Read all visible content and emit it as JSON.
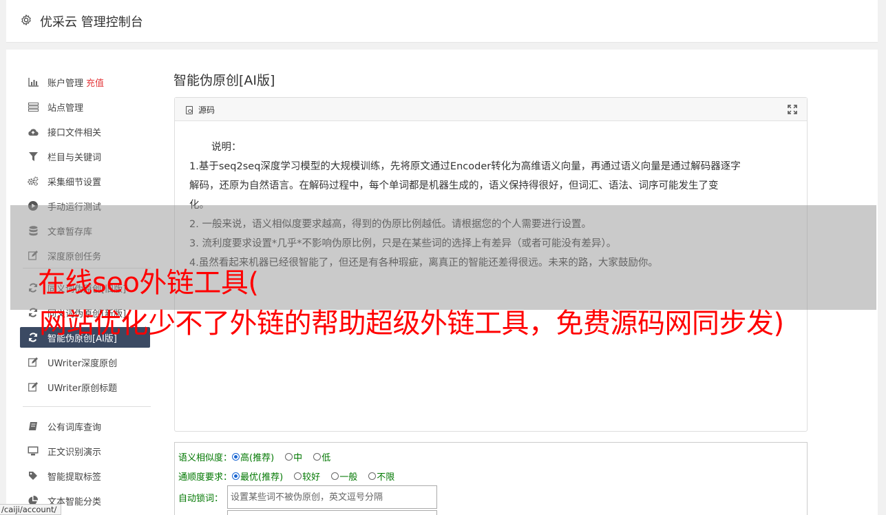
{
  "header": {
    "title": "优采云 管理控制台",
    "icon": "gear-icon"
  },
  "sidebar": {
    "items": [
      {
        "label": "账户管理",
        "extra": "充值",
        "icon": "bar-chart-icon"
      },
      {
        "label": "站点管理",
        "icon": "server-icon"
      },
      {
        "label": "接口文件相关",
        "icon": "cloud-upload-icon"
      },
      {
        "label": "栏目与关键词",
        "icon": "filter-icon"
      },
      {
        "label": "采集细节设置",
        "icon": "gears-icon"
      },
      {
        "label": "手动运行测试",
        "icon": "play-circle-icon"
      },
      {
        "label": "文章暂存库",
        "icon": "database-icon"
      },
      {
        "label": "深度原创任务",
        "icon": "edit-icon"
      },
      {
        "label": "同义词伪原创[旧版]",
        "icon": "refresh-icon"
      },
      {
        "label": "同义词伪原创[新版]",
        "icon": "refresh-icon"
      },
      {
        "label": "智能伪原创[AI版]",
        "icon": "refresh-icon"
      },
      {
        "label": "UWriter深度原创",
        "icon": "edit-icon"
      },
      {
        "label": "UWriter原创标题",
        "icon": "edit-icon"
      },
      {
        "label": "公有词库查询",
        "icon": "book-icon"
      },
      {
        "label": "正文识别演示",
        "icon": "monitor-icon"
      },
      {
        "label": "智能提取标签",
        "icon": "tag-icon"
      },
      {
        "label": "文本智能分类",
        "icon": "pie-chart-icon"
      }
    ]
  },
  "main": {
    "title": "智能伪原创[AI版]",
    "panel": {
      "header_label": "源码",
      "lines": [
        "说明：",
        "1.基于seq2seq深度学习模型的大规模训练，先将原文通过Encoder转化为高维语义向量，再通过语义向量是通过解码器逐字",
        "解码，还原为自然语言。在解码过程中，每个单词都是机器生成的，语义保持得很好，但词汇、语法、词序可能发生了变",
        "化。",
        "2. 一般来说，语义相似度要求越高，得到的伪原比例越低。请根据您的个人需要进行设置。",
        "3. 流利度要求设置*几乎*不影响伪原比例，只是在某些词的选择上有差异（或者可能没有差异）。",
        "4.虽然看起来机器已经很智能了，但还是有各种瑕疵，离真正的智能还差得很远。未来的路，大家鼓励你。"
      ]
    },
    "options": {
      "similarity": {
        "label": "语义相似度：",
        "choices": [
          "高(推荐)",
          "中",
          "低"
        ],
        "selected": "高(推荐)"
      },
      "fluency": {
        "label": "通顺度要求：",
        "choices": [
          "最优(推荐)",
          "较好",
          "一般",
          "不限"
        ],
        "selected": "最优(推荐)"
      },
      "lock": {
        "label": "自动锁词：",
        "placeholder": "设置某些词不被伪原创，英文逗号分隔"
      }
    }
  },
  "overlay": {
    "line1": "在线seo外链工具(",
    "line2": "网站优化少不了外链的帮助超级外链工具，免费源码网同步发)"
  },
  "statusbar": {
    "url": "/caiji/account/"
  },
  "colors": {
    "accent": "#3b4a63",
    "recharge": "#e4393c",
    "overlay_text": "#ff0000",
    "option_text": "#007700"
  }
}
